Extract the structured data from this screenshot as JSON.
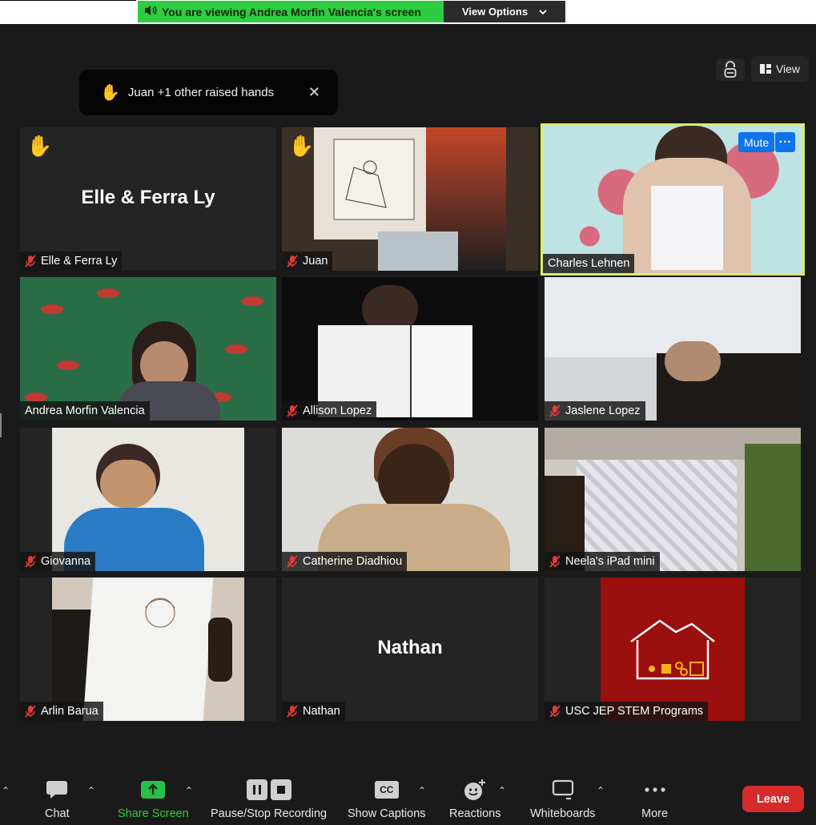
{
  "share_banner": {
    "message": "You are viewing Andrea Morfin Valencia's screen",
    "options_label": "View Options"
  },
  "raised_hands_toast": {
    "text": "Juan +1 other raised hands"
  },
  "header": {
    "view_label": "View"
  },
  "participants": [
    {
      "name": "Elle & Ferra Ly",
      "big_name": "Elle & Ferra Ly",
      "muted": true,
      "hand_raised": true,
      "video": false
    },
    {
      "name": "Juan",
      "muted": true,
      "hand_raised": true,
      "video": true
    },
    {
      "name": "Charles Lehnen",
      "muted": false,
      "hand_raised": false,
      "video": true,
      "active_speaker": true,
      "mute_label": "Mute"
    },
    {
      "name": "Andrea Morfin Valencia",
      "muted": false,
      "hand_raised": false,
      "video": true
    },
    {
      "name": "Allison Lopez",
      "muted": true,
      "hand_raised": false,
      "video": true
    },
    {
      "name": "Jaslene Lopez",
      "muted": true,
      "hand_raised": false,
      "video": true
    },
    {
      "name": "Giovanna",
      "muted": true,
      "hand_raised": false,
      "video": true
    },
    {
      "name": "Catherine Diadhiou",
      "muted": true,
      "hand_raised": false,
      "video": true
    },
    {
      "name": "Neela's iPad mini",
      "muted": true,
      "hand_raised": false,
      "video": true
    },
    {
      "name": "Arlin Barua",
      "muted": true,
      "hand_raised": false,
      "video": true
    },
    {
      "name": "Nathan",
      "big_name": "Nathan",
      "muted": true,
      "hand_raised": false,
      "video": false
    },
    {
      "name": "USC JEP STEM Programs",
      "muted": true,
      "hand_raised": false,
      "video": true
    }
  ],
  "toolbar": {
    "chat": "Chat",
    "share_screen": "Share Screen",
    "recording": "Pause/Stop Recording",
    "captions": "Show Captions",
    "captions_icon_text": "CC",
    "reactions": "Reactions",
    "whiteboards": "Whiteboards",
    "more": "More",
    "leave": "Leave"
  },
  "colors": {
    "banner_green": "#2ecc40",
    "active_speaker_border": "#d8ec6a",
    "leave_red": "#d62b2b",
    "accent_blue": "#0e72ed",
    "share_green": "#27c24c"
  }
}
